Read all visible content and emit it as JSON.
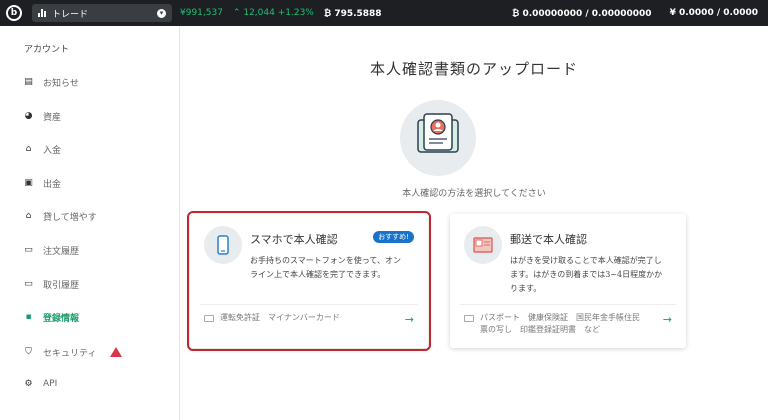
{
  "topbar": {
    "market": "トレード",
    "yen_price": "¥991,537",
    "change": "12,044 +1.23%",
    "btc_price": "795.5888",
    "btc_balance": "0.00000000 / 0.00000000",
    "yen_balance": "¥ 0.0000 / 0.0000"
  },
  "sidebar": {
    "title": "アカウント",
    "items": [
      {
        "label": "お知らせ"
      },
      {
        "label": "資産"
      },
      {
        "label": "入金"
      },
      {
        "label": "出金"
      },
      {
        "label": "貸して増やす"
      },
      {
        "label": "注文履歴"
      },
      {
        "label": "取引履歴"
      },
      {
        "label": "登録情報"
      },
      {
        "label": "セキュリティ"
      },
      {
        "label": "API"
      }
    ]
  },
  "main": {
    "title": "本人確認書類のアップロード",
    "subtitle": "本人確認の方法を選択してください",
    "cards": [
      {
        "title": "スマホで本人確認",
        "badge": "おすすめ!",
        "desc1": "お手持ちのスマートフォンを使って、オン",
        "desc2": "ライン上で本人確認を完了できます。",
        "docs1": "運転免許証　マイナンバーカード",
        "docs2": ""
      },
      {
        "title": "郵送で本人確認",
        "desc1": "はがきを受け取ることで本人確認が完了し",
        "desc2": "ます。はがきの到着までは3~4日程度かか",
        "desc3": "ります。",
        "docs1": "パスポート　健康保険証　国民年金手帳住民",
        "docs2": "票の写し　印鑑登録証明書　など"
      }
    ]
  },
  "colors": {
    "accent": "#1b9b6b",
    "highlight": "#c0272d",
    "badge": "#1a73c8",
    "warning": "#d9364b"
  }
}
